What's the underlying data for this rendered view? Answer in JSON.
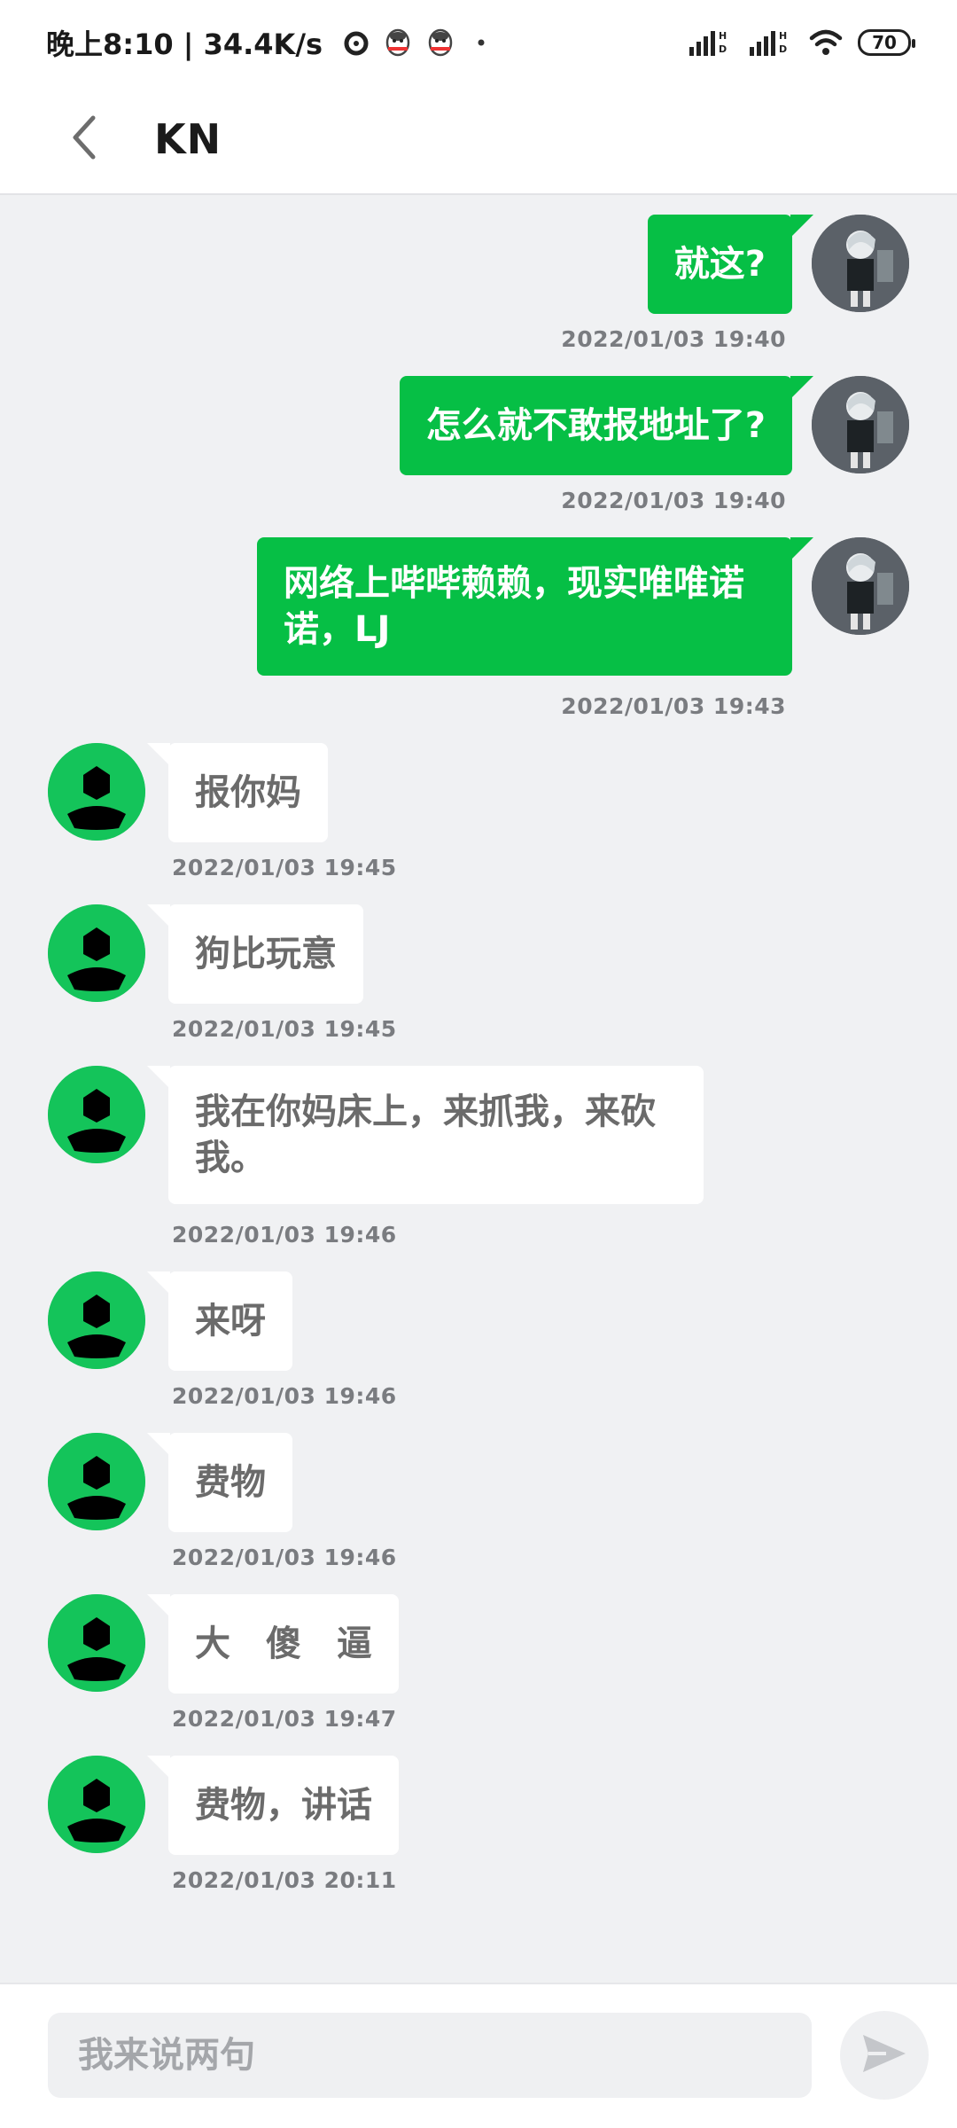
{
  "status_bar": {
    "time_speed": "晚上8:10 | 34.4K/s",
    "icons_left": [
      "alarm-icon",
      "qq-penguin-icon",
      "qq-penguin-icon",
      "dot-icon"
    ],
    "icons_right": [
      "signal-hd-icon",
      "signal-hd-icon",
      "wifi-icon"
    ],
    "battery": "70"
  },
  "header": {
    "back_icon": "chevron-left-icon",
    "title": "KN"
  },
  "colors": {
    "my_bubble": "#06bf45",
    "their_bubble": "#ffffff",
    "background": "#f0f1f3",
    "their_avatar": "#14c45a"
  },
  "messages": [
    {
      "side": "me",
      "text": "就这?",
      "time": "2022/01/03 19:40"
    },
    {
      "side": "me",
      "text": "怎么就不敢报地址了?",
      "time": "2022/01/03 19:40"
    },
    {
      "side": "me",
      "text": "网络上哔哔赖赖，现实唯唯诺诺，LJ",
      "time": "2022/01/03 19:43"
    },
    {
      "side": "them",
      "text": "报你妈",
      "time": "2022/01/03 19:45"
    },
    {
      "side": "them",
      "text": "狗比玩意",
      "time": "2022/01/03 19:45"
    },
    {
      "side": "them",
      "text": "我在你妈床上，来抓我，来砍我。",
      "time": "2022/01/03 19:46"
    },
    {
      "side": "them",
      "text": "来呀",
      "time": "2022/01/03 19:46"
    },
    {
      "side": "them",
      "text": "费物",
      "time": "2022/01/03 19:46"
    },
    {
      "side": "them",
      "text": "大　傻　逼",
      "time": "2022/01/03 19:47"
    },
    {
      "side": "them",
      "text": "费物，讲话",
      "time": "2022/01/03 20:11"
    }
  ],
  "input": {
    "placeholder": "我来说两句",
    "value": "",
    "send_icon": "send-arrow-icon"
  }
}
